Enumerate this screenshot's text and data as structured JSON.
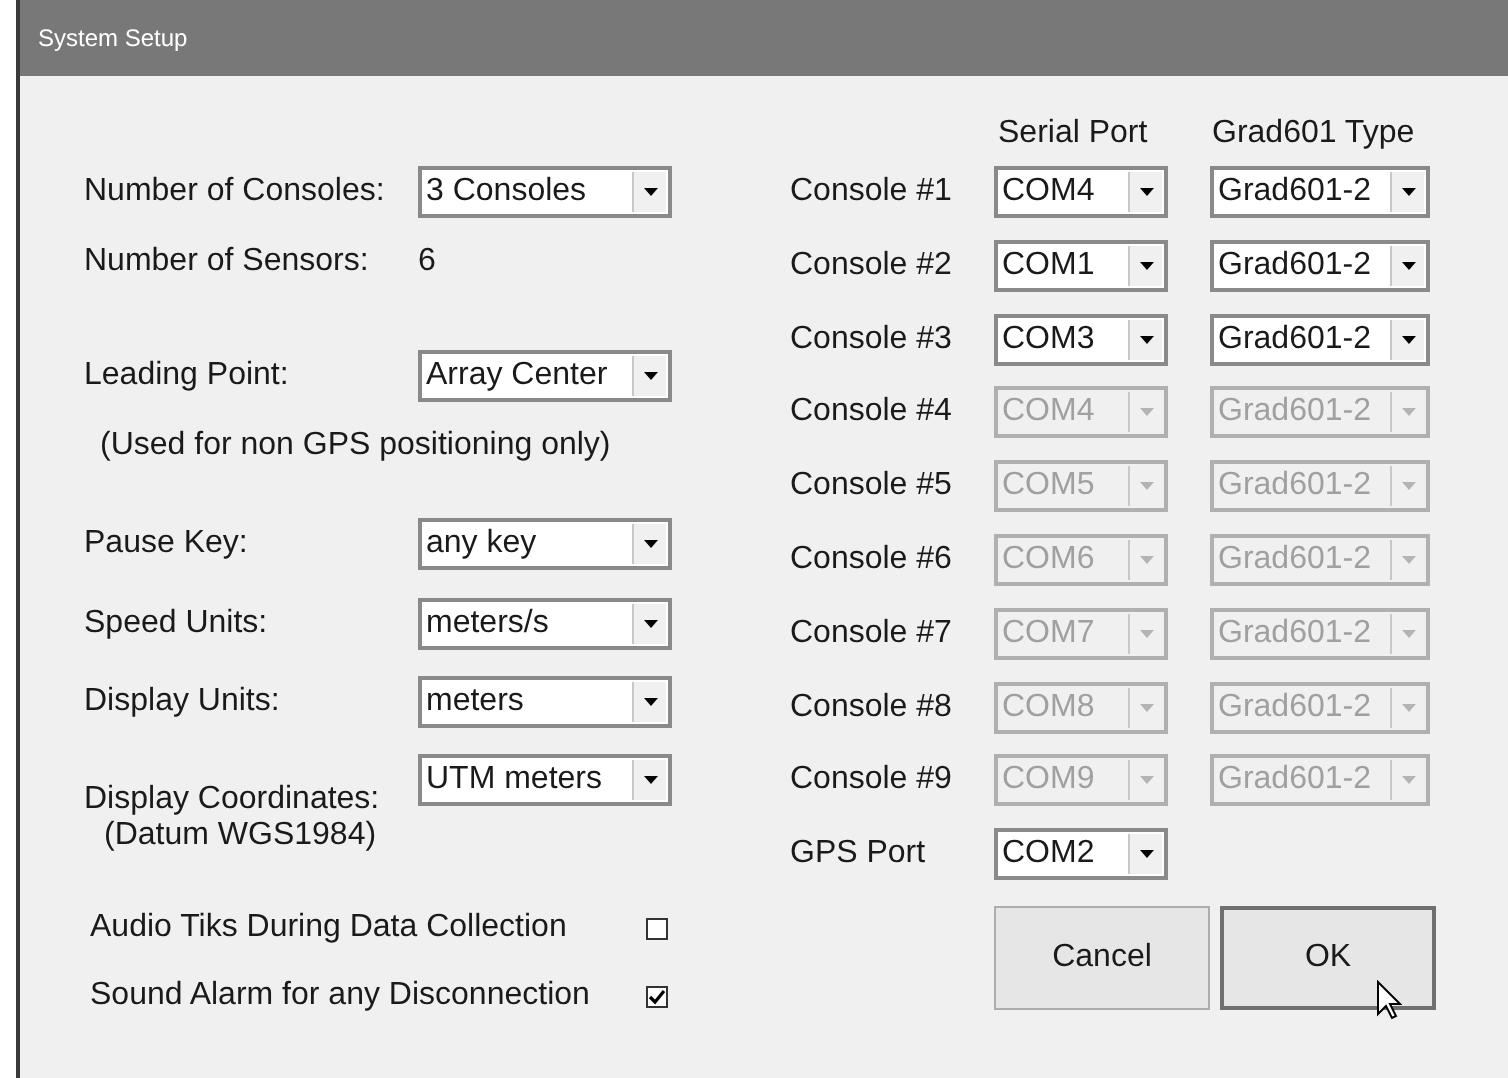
{
  "window": {
    "title": "System Setup"
  },
  "settings": [
    {
      "kind": "select",
      "label": "Number of Consoles:",
      "value": "3 Consoles"
    },
    {
      "kind": "readout",
      "label": "Number of Sensors:",
      "value": "6"
    },
    {
      "kind": "select",
      "label": "Leading Point:",
      "value": "Array Center"
    },
    {
      "kind": "note",
      "text": "(Used for non GPS positioning only)"
    },
    {
      "kind": "select",
      "label": "Pause Key:",
      "value": "any key"
    },
    {
      "kind": "select",
      "label": "Speed Units:",
      "value": "meters/s"
    },
    {
      "kind": "select",
      "label": "Display Units:",
      "value": "meters"
    },
    {
      "kind": "select",
      "label": "Display Coordinates:",
      "value": "UTM meters",
      "note": "(Datum WGS1984)"
    }
  ],
  "options": [
    {
      "label": "Audio Tiks During Data Collection",
      "checked": false
    },
    {
      "label": "Sound Alarm for any Disconnection",
      "checked": true
    }
  ],
  "consoles": {
    "columns": [
      "Serial Port",
      "Grad601 Type"
    ],
    "rows": [
      {
        "label": "Console #1",
        "port": "COM4",
        "type": "Grad601-2",
        "disabled": false
      },
      {
        "label": "Console #2",
        "port": "COM1",
        "type": "Grad601-2",
        "disabled": false
      },
      {
        "label": "Console #3",
        "port": "COM3",
        "type": "Grad601-2",
        "disabled": false
      },
      {
        "label": "Console #4",
        "port": "COM4",
        "type": "Grad601-2",
        "disabled": true
      },
      {
        "label": "Console #5",
        "port": "COM5",
        "type": "Grad601-2",
        "disabled": true
      },
      {
        "label": "Console #6",
        "port": "COM6",
        "type": "Grad601-2",
        "disabled": true
      },
      {
        "label": "Console #7",
        "port": "COM7",
        "type": "Grad601-2",
        "disabled": true
      },
      {
        "label": "Console #8",
        "port": "COM8",
        "type": "Grad601-2",
        "disabled": true
      },
      {
        "label": "Console #9",
        "port": "COM9",
        "type": "Grad601-2",
        "disabled": true
      }
    ],
    "gps": {
      "label": "GPS Port",
      "port": "COM2"
    }
  },
  "buttons": [
    {
      "label": "Cancel",
      "focused": false
    },
    {
      "label": "OK",
      "focused": true
    }
  ]
}
